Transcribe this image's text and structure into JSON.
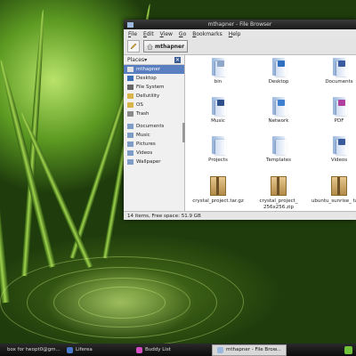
{
  "window": {
    "title": "mthapner - File Browser",
    "menus": [
      "File",
      "Edit",
      "View",
      "Go",
      "Bookmarks",
      "Help"
    ],
    "path_button": "mthapner"
  },
  "sidebar": {
    "header": "Places",
    "dropdown_glyph": "▾",
    "close_glyph": "✕",
    "items": [
      {
        "label": "mthapner",
        "icon": "home-icon",
        "color": "#e3e3e3",
        "selected": true
      },
      {
        "label": "Desktop",
        "icon": "desktop-icon",
        "color": "#3a6fb5"
      },
      {
        "label": "File System",
        "icon": "harddisk-icon",
        "color": "#666666"
      },
      {
        "label": "Dellutility",
        "icon": "drive-icon",
        "color": "#d9b44a"
      },
      {
        "label": "OS",
        "icon": "drive-icon",
        "color": "#d9b44a"
      },
      {
        "label": "Trash",
        "icon": "trash-icon",
        "color": "#8a8a8a"
      }
    ],
    "bookmarks": [
      {
        "label": "Documents",
        "icon": "folder-icon",
        "color": "#7f9cc6"
      },
      {
        "label": "Music",
        "icon": "folder-icon",
        "color": "#7f9cc6"
      },
      {
        "label": "Pictures",
        "icon": "folder-icon",
        "color": "#7f9cc6"
      },
      {
        "label": "Videos",
        "icon": "folder-icon",
        "color": "#7f9cc6"
      },
      {
        "label": "Wallpaper",
        "icon": "folder-icon",
        "color": "#7f9cc6"
      }
    ]
  },
  "files": [
    {
      "label": "bin",
      "kind": "folder",
      "emblem": "gear-emblem-icon",
      "emblem_color": "#8fa6c8"
    },
    {
      "label": "Desktop",
      "kind": "folder",
      "emblem": "desktop-emblem-icon",
      "emblem_color": "#2f6fc0"
    },
    {
      "label": "Documents",
      "kind": "folder",
      "emblem": "document-emblem-icon",
      "emblem_color": "#3c5aa0"
    },
    {
      "label": "Music",
      "kind": "folder",
      "emblem": "music-note-emblem-icon",
      "emblem_color": "#2e4f8a"
    },
    {
      "label": "Network",
      "kind": "folder",
      "emblem": "globe-emblem-icon",
      "emblem_color": "#3f7fd0"
    },
    {
      "label": "PDF",
      "kind": "folder",
      "emblem": "pdf-emblem-icon",
      "emblem_color": "#b040a0"
    },
    {
      "label": "Projects",
      "kind": "folder",
      "emblem": "",
      "emblem_color": "#ffffff"
    },
    {
      "label": "Templates",
      "kind": "folder",
      "emblem": "",
      "emblem_color": "#ffffff"
    },
    {
      "label": "Videos",
      "kind": "folder",
      "emblem": "film-emblem-icon",
      "emblem_color": "#3a5a9a"
    },
    {
      "label": "crystal_project.tar.gz",
      "kind": "archive"
    },
    {
      "label": "crystal_project_ 256x256.zip",
      "kind": "archive"
    },
    {
      "label": "ubuntu_sunrise_ tar.gz",
      "kind": "archive"
    }
  ],
  "status": "14 items, Free space: 51.9 GB",
  "taskbar": {
    "tasks": [
      {
        "label": "box for twopt0@gm...",
        "icon": "mail-icon",
        "color": "#c9c9c9"
      },
      {
        "label": "Liferea",
        "icon": "feed-reader-icon",
        "color": "#4a78c8"
      },
      {
        "label": "Buddy List",
        "icon": "chat-icon",
        "color": "#d34fbf"
      },
      {
        "label": "mthapner - File Brow...",
        "icon": "folder-icon",
        "color": "#9cb8de",
        "active": true
      }
    ],
    "tray_color": "#6fc23a"
  }
}
